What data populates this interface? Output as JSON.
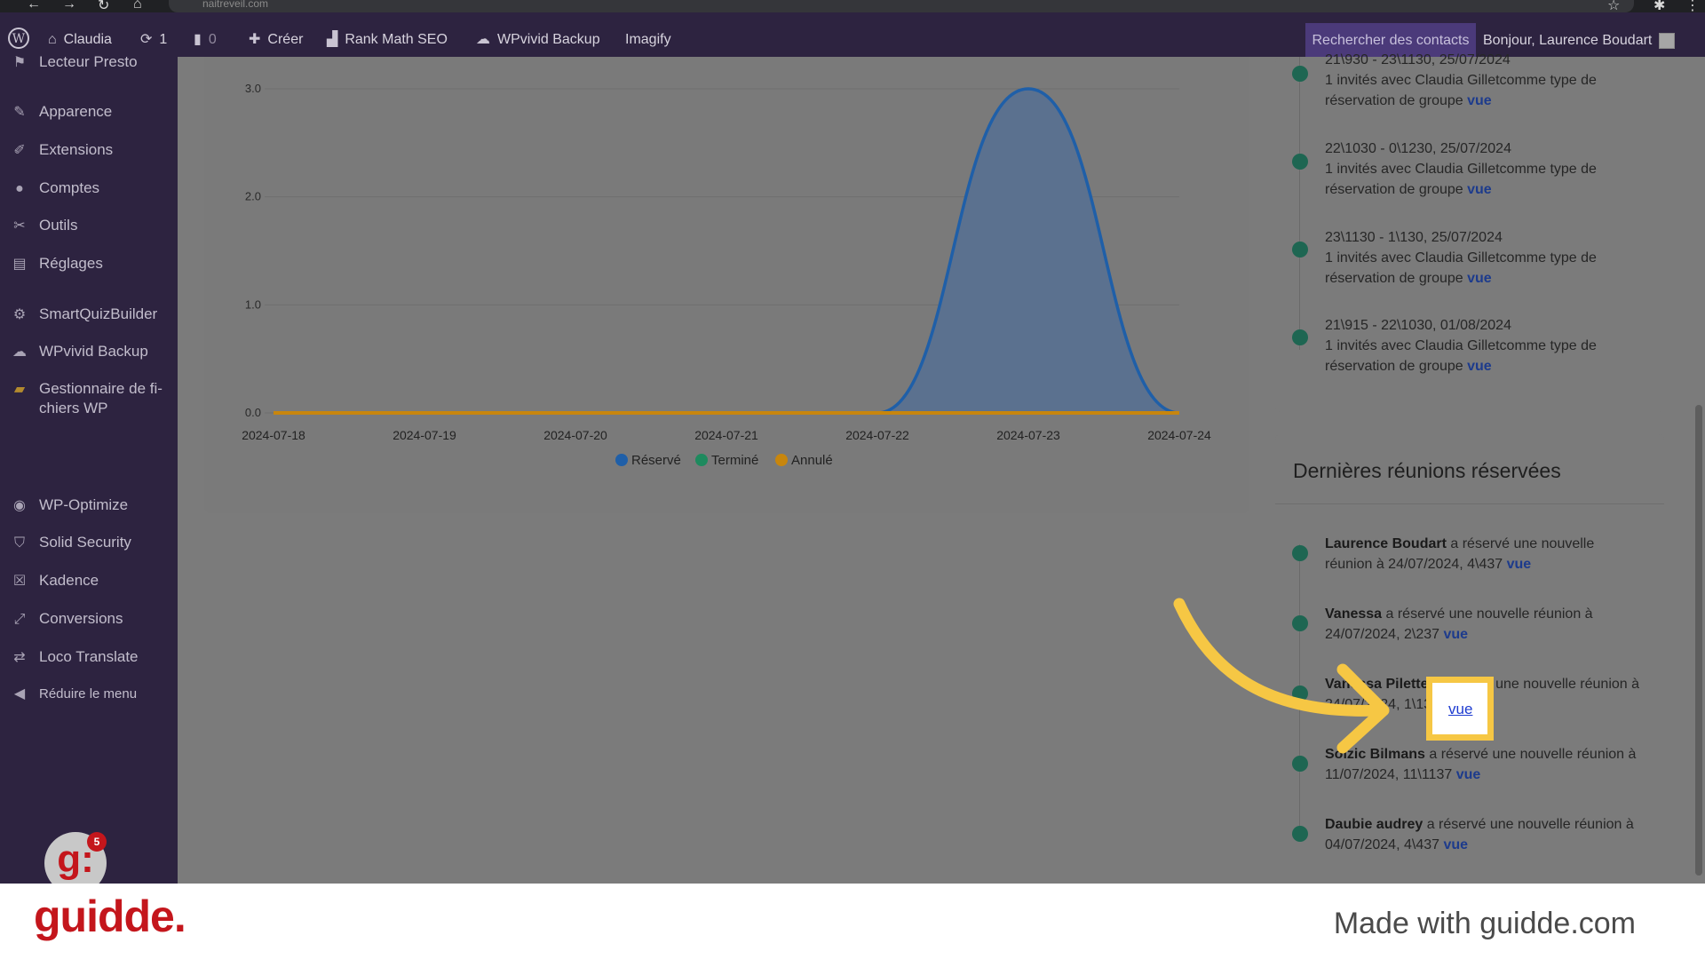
{
  "browser": {
    "url": "naitreveil.com"
  },
  "adminbar": {
    "site_name": "Claudia",
    "updates_count": "1",
    "comments_count": "0",
    "create_label": "Créer",
    "rank_math_label": "Rank Math SEO",
    "wpvivid_label": "WPvivid Backup",
    "imagify_label": "Imagify",
    "search_contacts_label": "Rechercher des contacts",
    "greeting": "Bonjour, Laurence Boudart"
  },
  "sidebar": {
    "items": [
      {
        "label": "Lecteur Presto",
        "icon": "flag-icon"
      },
      {
        "label": "Apparence",
        "icon": "brush-icon"
      },
      {
        "label": "Extensions",
        "icon": "plugin-icon"
      },
      {
        "label": "Comptes",
        "icon": "user-icon"
      },
      {
        "label": "Outils",
        "icon": "wrench-icon"
      },
      {
        "label": "Réglages",
        "icon": "settings-icon"
      },
      {
        "label": "SmartQuizBuilder",
        "icon": "gear-icon"
      },
      {
        "label": "WPvivid Backup",
        "icon": "cloud-icon"
      },
      {
        "label": "Gestionnaire de fi-\nchiers WP",
        "icon": "folder-icon"
      },
      {
        "label": "WP-Optimize",
        "icon": "optimize-icon"
      },
      {
        "label": "Solid Security",
        "icon": "shield-icon"
      },
      {
        "label": "Kadence",
        "icon": "kadence-icon"
      },
      {
        "label": "Conversions",
        "icon": "conversions-icon"
      },
      {
        "label": "Loco Translate",
        "icon": "translate-icon"
      },
      {
        "label": "Réduire le menu",
        "icon": "collapse-icon"
      }
    ],
    "badge_letter": "g:",
    "badge_count": "5"
  },
  "chart_data": {
    "type": "area",
    "x": [
      "2024-07-18",
      "2024-07-19",
      "2024-07-20",
      "2024-07-21",
      "2024-07-22",
      "2024-07-23",
      "2024-07-24"
    ],
    "series": [
      {
        "name": "Réservé",
        "values": [
          0,
          0,
          0,
          0,
          0,
          3,
          0
        ],
        "color": "#1f5fa8"
      },
      {
        "name": "Terminé",
        "values": [
          0,
          0,
          0,
          0,
          0,
          0,
          0
        ],
        "color": "#1e8a5e"
      },
      {
        "name": "Annulé",
        "values": [
          0,
          0,
          0,
          0,
          0,
          0,
          0
        ],
        "color": "#c8860d"
      }
    ],
    "y_ticks": [
      "0.0",
      "1.0",
      "2.0",
      "3.0"
    ],
    "ylim": [
      0,
      3
    ],
    "legend": "bottom"
  },
  "upcoming": {
    "items": [
      {
        "time": "21\\930 - 23\\1130, 25/07/2024",
        "desc": "1 invités avec Claudia Gilletcomme type de réservation de groupe",
        "link": "vue"
      },
      {
        "time": "22\\1030 - 0\\1230, 25/07/2024",
        "desc": "1 invités avec Claudia Gilletcomme type de réservation de groupe",
        "link": "vue"
      },
      {
        "time": "23\\1130 - 1\\130, 25/07/2024",
        "desc": "1 invités avec Claudia Gilletcomme type de réservation de groupe",
        "link": "vue"
      },
      {
        "time": "21\\915 - 22\\1030, 01/08/2024",
        "desc": "1 invités avec Claudia Gilletcomme type de réservation de groupe",
        "link": "vue"
      }
    ]
  },
  "recent": {
    "title": "Dernières réunions réservées",
    "items": [
      {
        "name": "Laurence Boudart",
        "action": " a réservé une nouvelle réunion à 24/07/2024, 4\\437 ",
        "link": "vue"
      },
      {
        "name": "Vanessa",
        "action": " a réservé une nouvelle réunion à 24/07/2024, 2\\237 ",
        "link": "vue"
      },
      {
        "name": "Vanessa Pilette",
        "action": " a réservé une nouvelle réunion à 24/07/2024, 1\\137 ",
        "link": "vue"
      },
      {
        "name": "Solzic Bilmans",
        "action": " a réservé une nouvelle réunion à 11/07/2024, 11\\1137 ",
        "link": "vue"
      },
      {
        "name": "Daubie audrey",
        "action": " a réservé une nouvelle réunion à 04/07/2024, 4\\437 ",
        "link": "vue"
      }
    ]
  },
  "highlight": {
    "link_label": "vue"
  },
  "footer": {
    "logo": "guidde.",
    "made_with": "Made with guidde.com"
  }
}
